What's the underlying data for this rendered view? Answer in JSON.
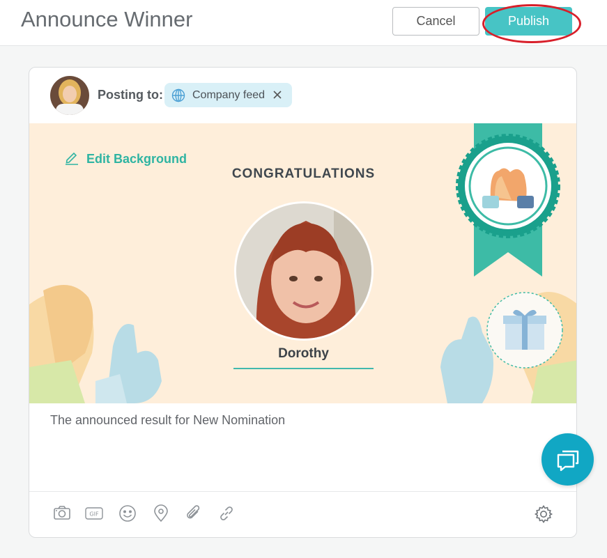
{
  "header": {
    "title": "Announce Winner",
    "cancel_label": "Cancel",
    "publish_label": "Publish"
  },
  "post": {
    "posting_to_label": "Posting to:",
    "feed_name": "Company feed"
  },
  "banner": {
    "edit_background_label": "Edit Background",
    "headline": "CONGRATULATIONS",
    "winner_name": "Dorothy"
  },
  "message": {
    "text": "The announced result for New Nomination"
  },
  "toolbar": {
    "icons": [
      "camera-icon",
      "gif-icon",
      "emoji-icon",
      "location-icon",
      "attachment-icon",
      "link-icon",
      "settings-icon"
    ],
    "gif_text": "GIF"
  },
  "colors": {
    "accent": "#47c4c5",
    "highlight_ring": "#d81f2a",
    "banner_bg": "#feeeda",
    "ribbon": "#3dbba6",
    "chat_fab": "#11a7c4"
  }
}
